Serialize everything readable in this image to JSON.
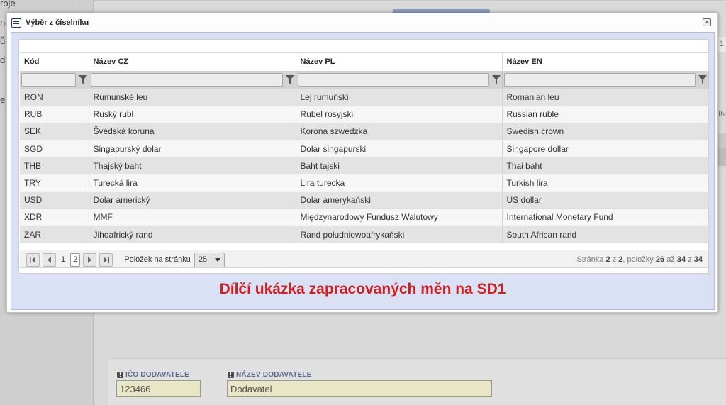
{
  "background": {
    "left_fragments": [
      "roje",
      "ná",
      "ů",
      "d",
      "er"
    ],
    "right_fragments": [
      "1,",
      "IN"
    ],
    "fields": [
      {
        "label": "IČO DODAVATELE",
        "value": "123466"
      },
      {
        "label": "NÁZEV DODAVATELE",
        "value": "Dodavatel"
      }
    ],
    "required_mark": "!"
  },
  "modal": {
    "title": "Výběr z číselníku",
    "close_label": "×",
    "icon": "window-list-icon"
  },
  "grid": {
    "columns": [
      "Kód",
      "Název CZ",
      "Název PL",
      "Název EN"
    ],
    "rows": [
      {
        "code": "RON",
        "cz": "Rumunské leu",
        "pl": "Lej rumuński",
        "en": "Romanian leu"
      },
      {
        "code": "RUB",
        "cz": "Ruský rubl",
        "pl": "Rubel rosyjski",
        "en": "Russian ruble"
      },
      {
        "code": "SEK",
        "cz": "Švédská koruna",
        "pl": "Korona szwedzka",
        "en": "Swedish crown"
      },
      {
        "code": "SGD",
        "cz": "Singapurský dolar",
        "pl": "Dolar singapurski",
        "en": "Singapore dollar"
      },
      {
        "code": "THB",
        "cz": "Thajský baht",
        "pl": "Baht tajski",
        "en": "Thai baht"
      },
      {
        "code": "TRY",
        "cz": "Turecká lira",
        "pl": "Lira turecka",
        "en": "Turkish lira"
      },
      {
        "code": "USD",
        "cz": "Dolar americký",
        "pl": "Dolar amerykański",
        "en": "US dollar"
      },
      {
        "code": "XDR",
        "cz": "MMF",
        "pl": "Międzynarodowy Fundusz Walutowy",
        "en": "International Monetary Fund"
      },
      {
        "code": "ZAR",
        "cz": "Jihoafrický rand",
        "pl": "Rand południowoafrykański",
        "en": "South African rand"
      }
    ]
  },
  "pager": {
    "pages": [
      "1",
      "2"
    ],
    "current_page": "2",
    "per_page_label": "Položek na stránku",
    "per_page_value": "25",
    "info": {
      "t1": "Stránka",
      "page": "2",
      "t2": "z",
      "pages": "2",
      "t3": ", položky",
      "from": "26",
      "t4": "až",
      "to": "34",
      "t5": "z",
      "total": "34"
    }
  },
  "note": "Dílčí ukázka zapracovaných měn na SD1",
  "colors": {
    "note": "#d21e1e",
    "modal_body": "#dbe1f4",
    "field_bg": "#e8e6c6"
  }
}
